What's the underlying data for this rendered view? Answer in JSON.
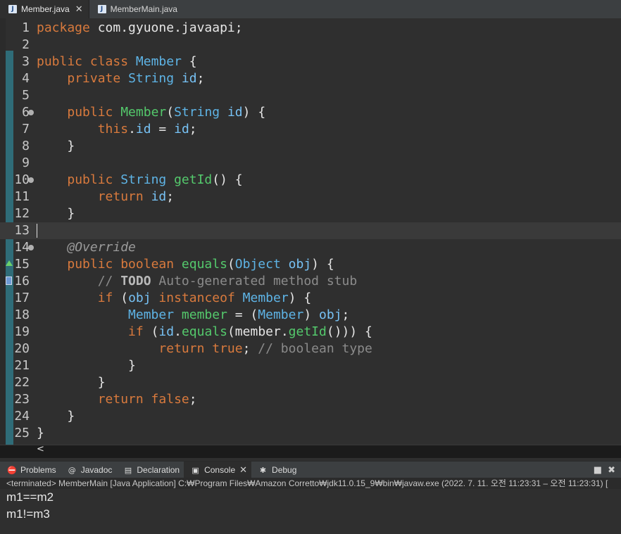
{
  "tabs": [
    {
      "label": "Member.java",
      "active": true,
      "icon": "java-file-icon",
      "closable": true
    },
    {
      "label": "MemberMain.java",
      "active": false,
      "icon": "java-file-icon",
      "closable": false
    }
  ],
  "editor": {
    "current_line": 13,
    "lines": [
      {
        "num": "1",
        "tokens": [
          [
            "k",
            "package "
          ],
          [
            "p",
            "com.gyuone.javaapi;"
          ]
        ]
      },
      {
        "num": "2",
        "tokens": []
      },
      {
        "num": "3",
        "tokens": [
          [
            "k",
            "public class "
          ],
          [
            "t",
            "Member"
          ],
          [
            "p",
            " {"
          ]
        ]
      },
      {
        "num": "4",
        "tokens": [
          [
            "p",
            "    "
          ],
          [
            "k",
            "private "
          ],
          [
            "t",
            "String "
          ],
          [
            "id",
            "id"
          ],
          [
            "p",
            ";"
          ]
        ]
      },
      {
        "num": "5",
        "tokens": []
      },
      {
        "num": "6",
        "fold": true,
        "tokens": [
          [
            "p",
            "    "
          ],
          [
            "k",
            "public "
          ],
          [
            "m",
            "Member"
          ],
          [
            "p",
            "("
          ],
          [
            "t",
            "String "
          ],
          [
            "id",
            "id"
          ],
          [
            "p",
            ") {"
          ]
        ]
      },
      {
        "num": "7",
        "tokens": [
          [
            "p",
            "        "
          ],
          [
            "k",
            "this"
          ],
          [
            "p",
            "."
          ],
          [
            "id",
            "id"
          ],
          [
            "p",
            " = "
          ],
          [
            "id",
            "id"
          ],
          [
            "p",
            ";"
          ]
        ]
      },
      {
        "num": "8",
        "tokens": [
          [
            "p",
            "    }"
          ]
        ]
      },
      {
        "num": "9",
        "tokens": []
      },
      {
        "num": "10",
        "fold": true,
        "tokens": [
          [
            "p",
            "    "
          ],
          [
            "k",
            "public "
          ],
          [
            "t",
            "String "
          ],
          [
            "m",
            "getId"
          ],
          [
            "p",
            "() {"
          ]
        ]
      },
      {
        "num": "11",
        "tokens": [
          [
            "p",
            "        "
          ],
          [
            "k",
            "return "
          ],
          [
            "id",
            "id"
          ],
          [
            "p",
            ";"
          ]
        ]
      },
      {
        "num": "12",
        "tokens": [
          [
            "p",
            "    }"
          ]
        ]
      },
      {
        "num": "13",
        "tokens": []
      },
      {
        "num": "14",
        "fold": true,
        "tokens": [
          [
            "p",
            "    "
          ],
          [
            "a",
            "@Override"
          ]
        ]
      },
      {
        "num": "15",
        "marker": "override",
        "tokens": [
          [
            "p",
            "    "
          ],
          [
            "k",
            "public boolean "
          ],
          [
            "m",
            "equals"
          ],
          [
            "p",
            "("
          ],
          [
            "t",
            "Object "
          ],
          [
            "id",
            "obj"
          ],
          [
            "p",
            ") {"
          ]
        ]
      },
      {
        "num": "16",
        "marker": "task",
        "tokens": [
          [
            "p",
            "        "
          ],
          [
            "c",
            "// "
          ],
          [
            "todo",
            "TODO"
          ],
          [
            "c",
            " Auto-generated method stub"
          ]
        ]
      },
      {
        "num": "17",
        "tokens": [
          [
            "p",
            "        "
          ],
          [
            "k",
            "if "
          ],
          [
            "p",
            "("
          ],
          [
            "id",
            "obj "
          ],
          [
            "k",
            "instanceof "
          ],
          [
            "t",
            "Member"
          ],
          [
            "p",
            ") {"
          ]
        ]
      },
      {
        "num": "18",
        "tokens": [
          [
            "p",
            "            "
          ],
          [
            "t",
            "Member "
          ],
          [
            "m",
            "member"
          ],
          [
            "p",
            " = ("
          ],
          [
            "t",
            "Member"
          ],
          [
            "p",
            ") "
          ],
          [
            "id",
            "obj"
          ],
          [
            "p",
            ";"
          ]
        ]
      },
      {
        "num": "19",
        "tokens": [
          [
            "p",
            "            "
          ],
          [
            "k",
            "if "
          ],
          [
            "p",
            "("
          ],
          [
            "id",
            "id"
          ],
          [
            "p",
            "."
          ],
          [
            "m",
            "equals"
          ],
          [
            "p",
            "(member."
          ],
          [
            "m",
            "getId"
          ],
          [
            "p",
            "())) {"
          ]
        ]
      },
      {
        "num": "20",
        "tokens": [
          [
            "p",
            "                "
          ],
          [
            "k",
            "return true"
          ],
          [
            "p",
            "; "
          ],
          [
            "c",
            "// boolean type"
          ]
        ]
      },
      {
        "num": "21",
        "tokens": [
          [
            "p",
            "            }"
          ]
        ]
      },
      {
        "num": "22",
        "tokens": [
          [
            "p",
            "        }"
          ]
        ]
      },
      {
        "num": "23",
        "tokens": [
          [
            "p",
            "        "
          ],
          [
            "k",
            "return false"
          ],
          [
            "p",
            ";"
          ]
        ]
      },
      {
        "num": "24",
        "tokens": [
          [
            "p",
            "    }"
          ]
        ]
      },
      {
        "num": "25",
        "tokens": [
          [
            "p",
            "}"
          ]
        ]
      }
    ]
  },
  "hscroll": {
    "left_arrow": "<"
  },
  "views": {
    "tabs": [
      {
        "label": "Problems",
        "icon": "problems-icon",
        "glyph": "⛔",
        "active": false
      },
      {
        "label": "Javadoc",
        "icon": "javadoc-icon",
        "glyph": "@",
        "active": false
      },
      {
        "label": "Declaration",
        "icon": "declaration-icon",
        "glyph": "▤",
        "active": false
      },
      {
        "label": "Console",
        "icon": "console-icon",
        "glyph": "▣",
        "active": true
      },
      {
        "label": "Debug",
        "icon": "debug-icon",
        "glyph": "✱",
        "active": false
      }
    ],
    "tool_icons": [
      {
        "name": "stop-icon",
        "glyph": "■"
      },
      {
        "name": "remove-launch-icon",
        "glyph": "✖"
      }
    ]
  },
  "console": {
    "header": "<terminated> MemberMain [Java Application] C:₩Program Files₩Amazon Corretto₩jdk11.0.15_9₩bin₩javaw.exe  (2022. 7. 11. 오전 11:23:31 – 오전 11:23:31) [",
    "output": [
      "m1==m2",
      "m1!=m3"
    ]
  }
}
